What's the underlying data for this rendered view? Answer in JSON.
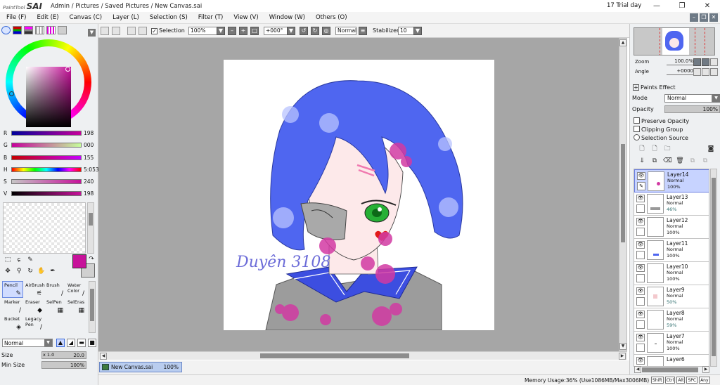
{
  "titlebar": {
    "logo_small": "PaintTool",
    "logo_big": "SAI",
    "path": "Admin / Pictures / Saved Pictures / New Canvas.sai",
    "trial": "17 Trial day",
    "minimize": "—",
    "maximize": "❐",
    "close": "✕"
  },
  "menu": [
    "File (F)",
    "Edit (E)",
    "Canvas (C)",
    "Layer (L)",
    "Selection (S)",
    "Filter (T)",
    "View (V)",
    "Window (W)",
    "Others (O)"
  ],
  "color": {
    "fg": "#c7129a",
    "sliders": [
      {
        "label": "R",
        "value": "198"
      },
      {
        "label": "G",
        "value": "000"
      },
      {
        "label": "B",
        "value": "155"
      },
      {
        "label": "H",
        "value": "5:053"
      },
      {
        "label": "S",
        "value": "240"
      },
      {
        "label": "V",
        "value": "198"
      }
    ]
  },
  "brushes": [
    {
      "label": "Pencil",
      "icon": "pencil-icon"
    },
    {
      "label": "AirBrush",
      "icon": "airbrush-icon"
    },
    {
      "label": "Brush",
      "icon": "brush-icon"
    },
    {
      "label": "Water Color",
      "icon": "watercolor-icon"
    },
    {
      "label": "Marker",
      "icon": "marker-icon"
    },
    {
      "label": "Eraser",
      "icon": "eraser-icon"
    },
    {
      "label": "SelPen",
      "icon": "selpen-icon"
    },
    {
      "label": "SelEras",
      "icon": "seleras-icon"
    },
    {
      "label": "Bucket",
      "icon": "bucket-icon"
    },
    {
      "label": "Legacy Pen",
      "icon": "legacy-pen-icon"
    }
  ],
  "brush_props": {
    "blend_mode": "Normal",
    "size_label": "Size",
    "size_prefix": "x 1.0",
    "size_value": "20.0",
    "minsize_label": "Min Size",
    "minsize_value": "100%"
  },
  "toolbar": {
    "selection_label": "Selection",
    "zoom": "100%",
    "rotation": "+000°",
    "blend": "Normal",
    "stabilizer_label": "Stabilizer",
    "stabilizer_value": "10"
  },
  "canvas": {
    "signature": "Duyên 3108",
    "hair_color": "#4f66f0",
    "skin_color": "#fde9ea",
    "blush_color": "#d23aa3"
  },
  "doc_tab": {
    "name": "New Canvas.sai",
    "zoom": "100%"
  },
  "status": {
    "memory": "Memory Usage:36% (Use1086MB/Max3006MB)",
    "keys": [
      "Shift",
      "Ctrl",
      "Alt",
      "SPC",
      "Any"
    ]
  },
  "navigator": {
    "zoom_label": "Zoom",
    "zoom_value": "100.0%",
    "angle_label": "Angle",
    "angle_value": "+0000"
  },
  "layer_panel": {
    "paints_effect": "Paints Effect",
    "mode_label": "Mode",
    "mode_value": "Normal",
    "opacity_label": "Opacity",
    "opacity_value": "100%",
    "preserve_opacity": "Preserve Opacity",
    "clipping_group": "Clipping Group",
    "selection_source": "Selection Source"
  },
  "layers": [
    {
      "name": "Layer14",
      "mode": "Normal",
      "opacity": "100%",
      "selected": true
    },
    {
      "name": "Layer13",
      "mode": "Normal",
      "opacity": "46%"
    },
    {
      "name": "Layer12",
      "mode": "Normal",
      "opacity": "100%"
    },
    {
      "name": "Layer11",
      "mode": "Normal",
      "opacity": "100%"
    },
    {
      "name": "Layer10",
      "mode": "Normal",
      "opacity": "100%"
    },
    {
      "name": "Layer9",
      "mode": "Normal",
      "opacity": "50%"
    },
    {
      "name": "Layer8",
      "mode": "Normal",
      "opacity": "59%"
    },
    {
      "name": "Layer7",
      "mode": "Normal",
      "opacity": "100%"
    },
    {
      "name": "Layer6",
      "mode": "",
      "opacity": ""
    }
  ]
}
